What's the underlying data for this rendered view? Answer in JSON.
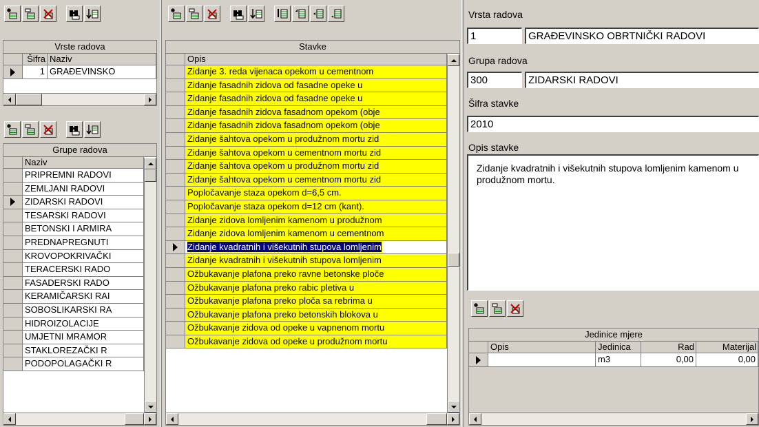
{
  "left_top": {
    "title": "Vrste radova",
    "columns": [
      "Šifra",
      "Naziv"
    ],
    "rows": [
      {
        "sifra": "1",
        "naziv": "GRAĐEVINSKO"
      }
    ]
  },
  "left_bottom": {
    "title": "Grupe radova",
    "columns": [
      "Naziv"
    ],
    "rows": [
      "PRIPREMNI RADOVI",
      "ZEMLJANI RADOVI",
      "ZIDARSKI RADOVI",
      "TESARSKI RADOVI",
      "BETONSKI I ARMIRA",
      "PREDNAPREGNUTI",
      "KROVOPOKRIVAČKI",
      "TERACERSKI RADO",
      "FASADERSKI RADO",
      "KERAMIČARSKI RAI",
      "SOBOSLIKARSKI RA",
      "HIDROIZOLACIJE",
      "UMJETNI MRAMOR",
      "STAKLOREZAČKI R",
      "PODOPOLAGAČKI R"
    ],
    "selected_index": 2
  },
  "middle": {
    "title": "Stavke",
    "columns": [
      "Opis"
    ],
    "rows": [
      "Zidanje 3. reda vijenaca opekom u cementnom",
      "Zidanje fasadnih zidova od fasadne opeke u",
      "Zidanje fasadnih zidova od fasadne opeke u",
      "Zidanje fasadnih zidova fasadnom opekom (obje",
      "Zidanje fasadnih zidova fasadnom opekom (obje",
      "Zidanje šahtova opekom u produžnom mortu zid",
      "Zidanje šahtova opekom u cementnom mortu zid",
      "Zidanje šahtova opekom u produžnom mortu zid",
      "Zidanje šahtova opekom u cementnom mortu zid",
      "Popločavanje staza opekom d=6,5 cm.",
      "Popločavanje staza opekom d=12 cm (kant).",
      "Zidanje zidova lomljenim kamenom u produžnom",
      "Zidanje zidova lomljenim kamenom u cementnom",
      "Zidanje kvadratnih i višekutnih stupova lomljenim",
      "Zidanje kvadratnih i višekutnih stupova lomljenim",
      "Ožbukavanje plafona preko ravne betonske ploče",
      "Ožbukavanje plafona preko rabic pletiva u",
      "Ožbukavanje plafona preko ploča sa rebrima u",
      "Ožbukavanje plafona preko betonskih blokova u",
      "Ožbukavanje zidova od opeke u vapnenom mortu",
      "Ožbukavanje zidova od opeke u produžnom mortu"
    ],
    "selected_index": 13
  },
  "right": {
    "vrsta_label": "Vrsta radova",
    "vrsta_code": "1",
    "vrsta_name": "GRAĐEVINSKO OBRTNIČKI RADOVI",
    "grupa_label": "Grupa radova",
    "grupa_code": "300",
    "grupa_name": "ZIDARSKI RADOVI",
    "sifra_label": "Šifra stavke",
    "sifra_value": "2010",
    "opis_label": "Opis stavke",
    "opis_value": "Zidanje kvadratnih i višekutnih stupova lomljenim kamenom u produžnom mortu."
  },
  "units": {
    "title": "Jedinice mjere",
    "columns": [
      "Opis",
      "Jedinica",
      "Rad",
      "Materijal"
    ],
    "row": {
      "opis": "",
      "jedinica": "m3",
      "rad": "0,00",
      "materijal": "0,00"
    }
  },
  "colors": {
    "highlight_yellow": "#ffff00",
    "selection_navy": "#000080",
    "window_gray": "#d4d0c8"
  }
}
